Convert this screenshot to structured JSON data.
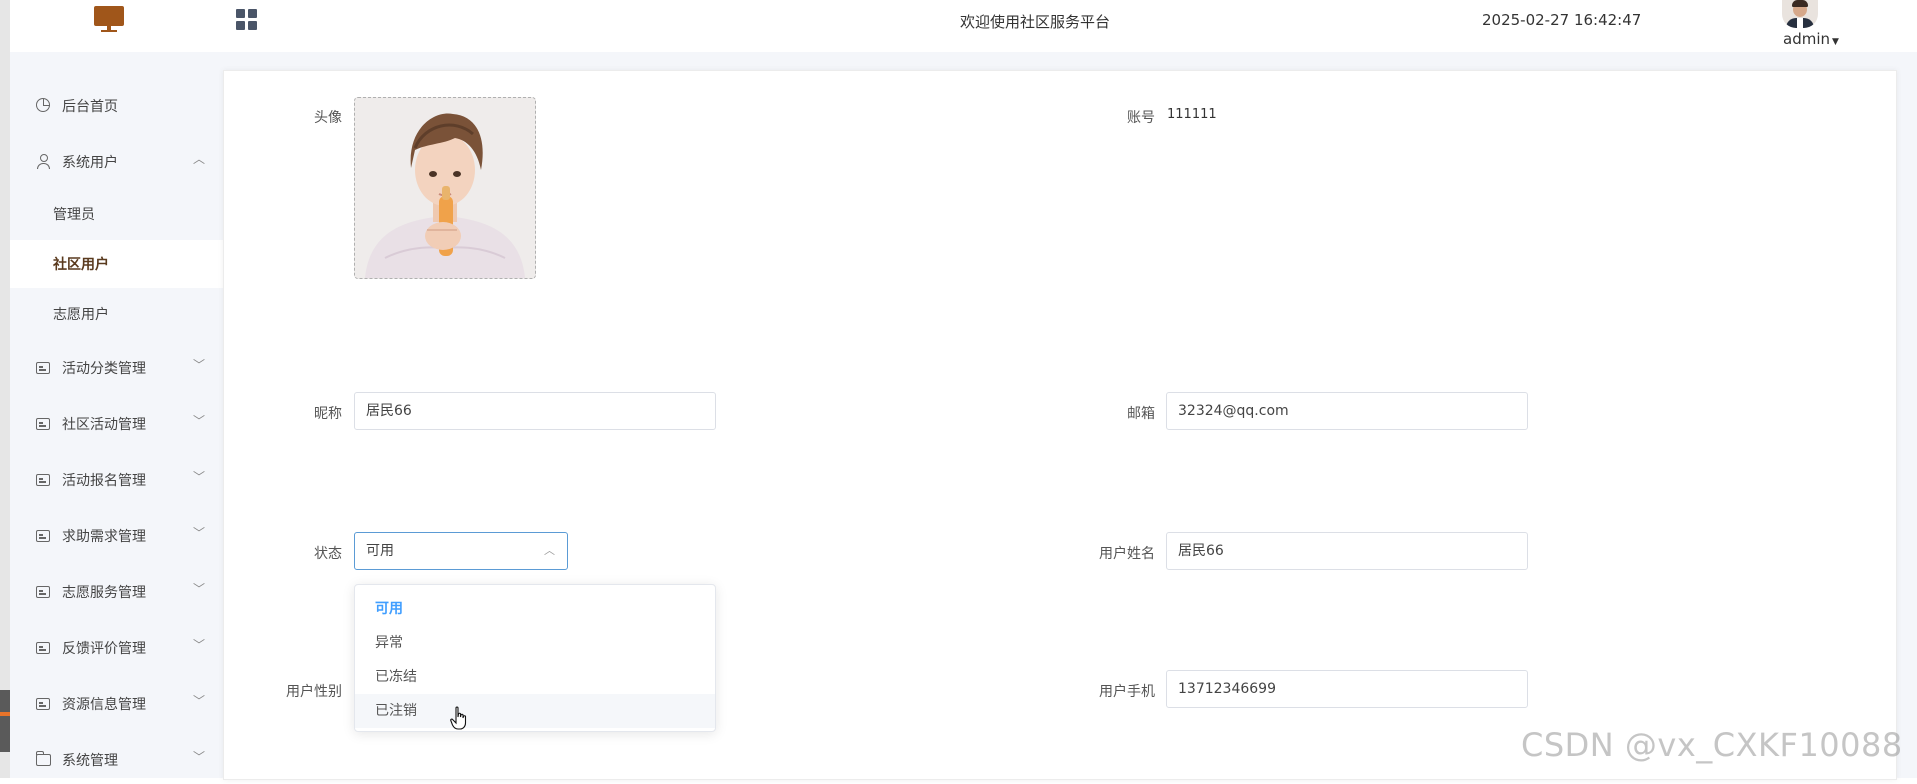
{
  "header": {
    "site_title": "欢迎使用社区服务平台",
    "datetime": "2025-02-27 16:42:47",
    "user_name": "admin",
    "icons": [
      "monitor-logo-icon",
      "grid-menu-icon",
      "avatar",
      "chevron-down-icon"
    ]
  },
  "sidebar": {
    "items": [
      {
        "label": "后台首页",
        "icon": "clock-icon"
      },
      {
        "label": "系统用户",
        "icon": "user-icon",
        "expanded": true,
        "children": [
          {
            "label": "管理员"
          },
          {
            "label": "社区用户",
            "active": true
          },
          {
            "label": "志愿用户"
          }
        ]
      },
      {
        "label": "活动分类管理",
        "icon": "doc-icon"
      },
      {
        "label": "社区活动管理",
        "icon": "doc-icon"
      },
      {
        "label": "活动报名管理",
        "icon": "doc-icon"
      },
      {
        "label": "求助需求管理",
        "icon": "doc-icon"
      },
      {
        "label": "志愿服务管理",
        "icon": "doc-icon"
      },
      {
        "label": "反馈评价管理",
        "icon": "doc-icon"
      },
      {
        "label": "资源信息管理",
        "icon": "doc-icon"
      },
      {
        "label": "系统管理",
        "icon": "folder-icon"
      }
    ]
  },
  "form": {
    "avatar_label": "头像",
    "account_label": "账号",
    "account_value": "111111",
    "nickname_label": "昵称",
    "nickname_value": "居民66",
    "email_label": "邮箱",
    "email_value": "32324@qq.com",
    "status_label": "状态",
    "status_value": "可用",
    "realname_label": "用户姓名",
    "realname_value": "居民66",
    "gender_label": "用户性别",
    "phone_label": "用户手机",
    "phone_value": "13712346699"
  },
  "status_dropdown": {
    "options": [
      "可用",
      "异常",
      "已冻结",
      "已注销"
    ],
    "selected": "可用",
    "hovered": "已注销"
  },
  "watermark": "CSDN @vx_CXKF10088",
  "colors": {
    "accent": "#409eff",
    "sidebar_bg": "#f4f6fa",
    "active_menu_text": "#5a3a1e",
    "logo": "#a0561a"
  }
}
